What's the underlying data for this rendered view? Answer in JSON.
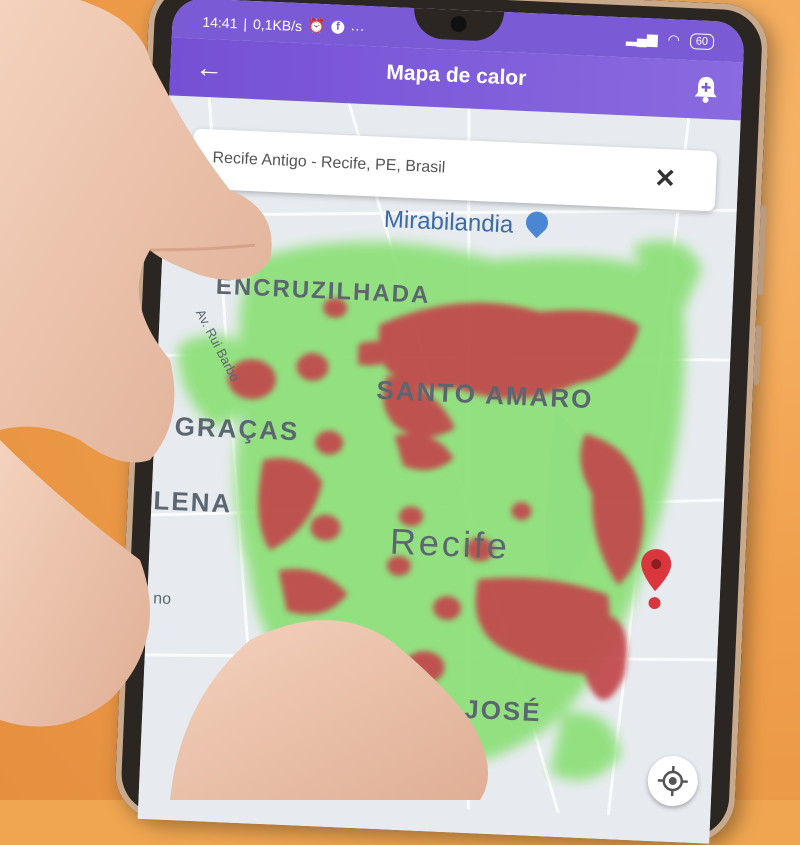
{
  "status": {
    "time": "14:41",
    "speed": "0,1KB/s",
    "battery": "60"
  },
  "appbar": {
    "title": "Mapa de calor",
    "back_icon": "arrow-left-icon",
    "action_icon": "bell-plus-icon"
  },
  "search": {
    "value": "Recife Antigo - Recife, PE, Brasil",
    "clear_icon": "close-icon"
  },
  "map": {
    "labels": {
      "poi": "Mirabilandia",
      "encruzilhada": "ENCRUZILHADA",
      "santo_amaro": "SANTO AMARO",
      "gracas": "GRAÇAS",
      "lena": "LENA",
      "recife": "Recife",
      "sao_jose": "SÃO JOSÉ",
      "street": "Av. Rui Barbo",
      "partial": "no"
    },
    "heat_colors": {
      "low": "#8ee07a",
      "high": "#c2464b"
    },
    "location_button_icon": "my-location-icon",
    "marker_icon": "map-pin-icon"
  }
}
